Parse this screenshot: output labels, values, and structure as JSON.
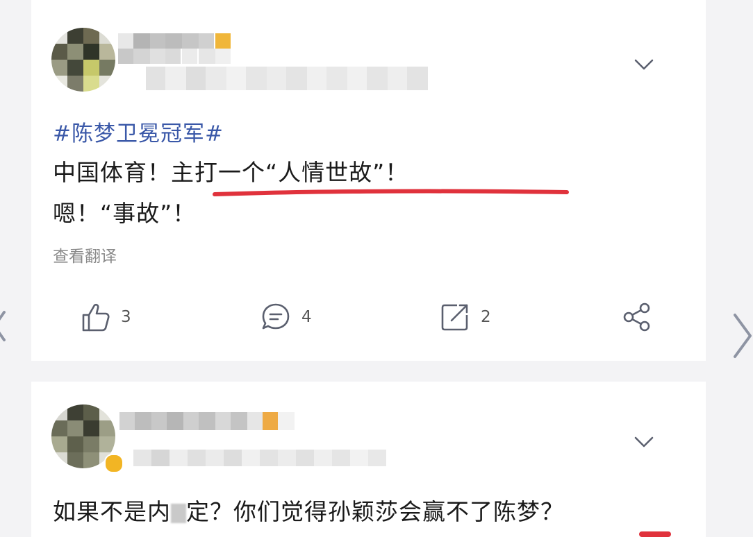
{
  "feed": {
    "posts": [
      {
        "hashtag": "#陈梦卫冕冠军#",
        "lines": [
          "中国体育！主打一个“人情世故”！",
          "嗯！“事故”！"
        ],
        "translate_link": "查看翻译",
        "actions": {
          "like_count": "3",
          "comment_count": "4",
          "repost_count": "2"
        }
      },
      {
        "text_before_redaction": "如果不是内",
        "text_after_redaction": "定？你们觉得孙颖莎会赢不了陈梦？"
      }
    ]
  },
  "icons": {
    "like": "thumbs-up-icon",
    "comment": "comment-icon",
    "repost": "repost-icon",
    "share": "share-icon",
    "more": "chevron-down-icon",
    "next": "chevron-right-icon"
  },
  "colors": {
    "hashtag": "#3a58a8",
    "highlight_mark": "#e0323c",
    "icon_gray": "#5a5f6e"
  }
}
